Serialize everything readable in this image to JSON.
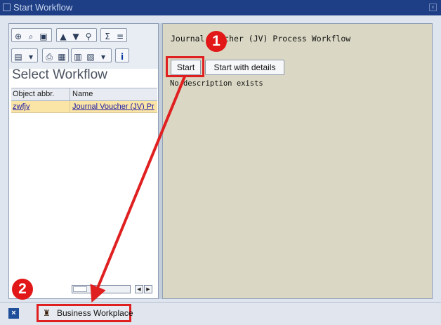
{
  "window": {
    "title": "Start Workflow"
  },
  "left_panel": {
    "title": "Select Workflow",
    "columns": [
      "Object abbr.",
      "Name"
    ],
    "rows": [
      {
        "abbr": "zwfjv",
        "name": "Journal Voucher (JV) Pr"
      }
    ]
  },
  "right_panel": {
    "workflow_title": "Journal Voucher (JV) Process Workflow",
    "start_label": "Start",
    "start_details_label": "Start with details",
    "description": "No description exists"
  },
  "statusbar": {
    "workplace_label": "Business Workplace"
  },
  "annotations": {
    "badge1": "1",
    "badge2": "2",
    "color": "#e02020"
  }
}
